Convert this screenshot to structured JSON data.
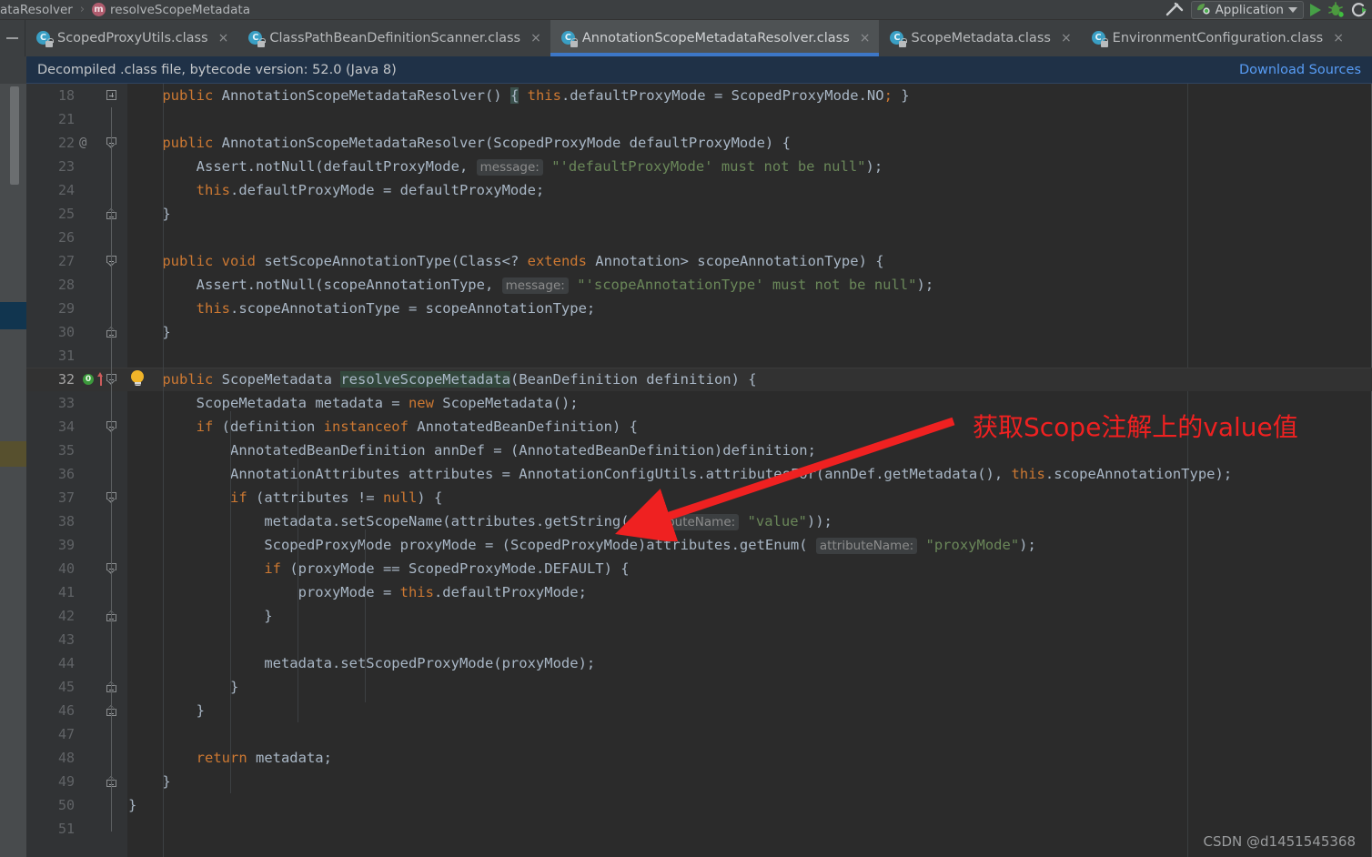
{
  "breadcrumb": {
    "class_fragment": "ataResolver",
    "separator": "›",
    "method_icon": "m",
    "method": "resolveScopeMetadata"
  },
  "toolbar": {
    "build_icon": "hammer-icon",
    "run_config_label": "Application",
    "run_config_icon": "application-run-icon",
    "run_icon": "run-icon",
    "debug_icon": "debug-icon",
    "rerun_icon": "rerun-icon"
  },
  "tabs": {
    "collapse_label": "—",
    "items": [
      {
        "label": "ScopedProxyUtils.class",
        "icon": "java-class-decompiled-icon",
        "active": false,
        "closable": true
      },
      {
        "label": "ClassPathBeanDefinitionScanner.class",
        "icon": "java-class-decompiled-icon",
        "active": false,
        "closable": true
      },
      {
        "label": "AnnotationScopeMetadataResolver.class",
        "icon": "java-class-decompiled-icon",
        "active": true,
        "closable": true
      },
      {
        "label": "ScopeMetadata.class",
        "icon": "java-class-decompiled-icon",
        "active": false,
        "closable": true
      },
      {
        "label": "EnvironmentConfiguration.class",
        "icon": "java-class-decompiled-icon",
        "active": false,
        "closable": true
      }
    ]
  },
  "banner": {
    "message": "Decompiled .class file, bytecode version: 52.0 (Java 8)",
    "link": "Download Sources"
  },
  "editor": {
    "current_line": 32,
    "lines": [
      {
        "n": "18",
        "anno": "",
        "fold": "plus",
        "cur": false,
        "tokens": [
          {
            "t": "    ",
            "c": "punc"
          },
          {
            "t": "public ",
            "c": "kw"
          },
          {
            "t": "AnnotationScopeMetadataResolver",
            "c": "typ"
          },
          {
            "t": "() ",
            "c": "punc"
          },
          {
            "t": "{",
            "c": "brace-hl"
          },
          {
            "t": " ",
            "c": "punc"
          },
          {
            "t": "this",
            "c": "kw"
          },
          {
            "t": ".defaultProxyMode = ",
            "c": "punc"
          },
          {
            "t": "ScopedProxyMode",
            "c": "typ"
          },
          {
            "t": ".NO",
            "c": "punc"
          },
          {
            "t": ";",
            "c": "kw"
          },
          {
            "t": " }",
            "c": "punc"
          }
        ]
      },
      {
        "n": "21",
        "anno": "",
        "fold": "",
        "cur": false,
        "tokens": []
      },
      {
        "n": "22",
        "anno": "@",
        "fold": "open",
        "cur": false,
        "tokens": [
          {
            "t": "    ",
            "c": "punc"
          },
          {
            "t": "public ",
            "c": "kw"
          },
          {
            "t": "AnnotationScopeMetadataResolver",
            "c": "typ"
          },
          {
            "t": "(",
            "c": "punc"
          },
          {
            "t": "ScopedProxyMode",
            "c": "typ"
          },
          {
            "t": " defaultProxyMode) {",
            "c": "punc"
          }
        ]
      },
      {
        "n": "23",
        "anno": "",
        "fold": "",
        "cur": false,
        "tokens": [
          {
            "t": "        ",
            "c": "punc"
          },
          {
            "t": "Assert",
            "c": "typ"
          },
          {
            "t": ".notNull(defaultProxyMode, ",
            "c": "punc"
          },
          {
            "t": "message:",
            "c": "hint"
          },
          {
            "t": " ",
            "c": "punc"
          },
          {
            "t": "\"'defaultProxyMode' must not be null\"",
            "c": "str"
          },
          {
            "t": ");",
            "c": "punc"
          }
        ]
      },
      {
        "n": "24",
        "anno": "",
        "fold": "",
        "cur": false,
        "tokens": [
          {
            "t": "        ",
            "c": "punc"
          },
          {
            "t": "this",
            "c": "kw"
          },
          {
            "t": ".defaultProxyMode = defaultProxyMode;",
            "c": "punc"
          }
        ]
      },
      {
        "n": "25",
        "anno": "",
        "fold": "close",
        "cur": false,
        "tokens": [
          {
            "t": "    }",
            "c": "punc"
          }
        ]
      },
      {
        "n": "26",
        "anno": "",
        "fold": "",
        "cur": false,
        "tokens": []
      },
      {
        "n": "27",
        "anno": "",
        "fold": "open",
        "cur": false,
        "tokens": [
          {
            "t": "    ",
            "c": "punc"
          },
          {
            "t": "public void ",
            "c": "kw"
          },
          {
            "t": "setScopeAnnotationType",
            "c": "typ"
          },
          {
            "t": "(",
            "c": "punc"
          },
          {
            "t": "Class",
            "c": "typ"
          },
          {
            "t": "<? ",
            "c": "punc"
          },
          {
            "t": "extends ",
            "c": "kw"
          },
          {
            "t": "Annotation",
            "c": "typ"
          },
          {
            "t": "> scopeAnnotationType) {",
            "c": "punc"
          }
        ]
      },
      {
        "n": "28",
        "anno": "",
        "fold": "",
        "cur": false,
        "tokens": [
          {
            "t": "        ",
            "c": "punc"
          },
          {
            "t": "Assert",
            "c": "typ"
          },
          {
            "t": ".notNull(scopeAnnotationType, ",
            "c": "punc"
          },
          {
            "t": "message:",
            "c": "hint"
          },
          {
            "t": " ",
            "c": "punc"
          },
          {
            "t": "\"'scopeAnnotationType' must not be null\"",
            "c": "str"
          },
          {
            "t": ");",
            "c": "punc"
          }
        ]
      },
      {
        "n": "29",
        "anno": "",
        "fold": "",
        "cur": false,
        "tokens": [
          {
            "t": "        ",
            "c": "punc"
          },
          {
            "t": "this",
            "c": "kw"
          },
          {
            "t": ".scopeAnnotationType = scopeAnnotationType;",
            "c": "punc"
          }
        ]
      },
      {
        "n": "30",
        "anno": "",
        "fold": "close",
        "cur": false,
        "tokens": [
          {
            "t": "    }",
            "c": "punc"
          }
        ]
      },
      {
        "n": "31",
        "anno": "",
        "fold": "",
        "cur": false,
        "tokens": []
      },
      {
        "n": "32",
        "anno": "",
        "fold": "open",
        "cur": true,
        "tokens": [
          {
            "t": "    ",
            "c": "punc"
          },
          {
            "t": "public ",
            "c": "kw"
          },
          {
            "t": "ScopeMetadata",
            "c": "typ"
          },
          {
            "t": " ",
            "c": "punc"
          },
          {
            "t": "resolveScopeMetadata",
            "c": "hl-meth"
          },
          {
            "t": "(",
            "c": "punc"
          },
          {
            "t": "BeanDefinition",
            "c": "typ"
          },
          {
            "t": " definition) {",
            "c": "punc"
          }
        ]
      },
      {
        "n": "33",
        "anno": "",
        "fold": "",
        "cur": false,
        "tokens": [
          {
            "t": "        ",
            "c": "punc"
          },
          {
            "t": "ScopeMetadata",
            "c": "typ"
          },
          {
            "t": " metadata = ",
            "c": "punc"
          },
          {
            "t": "new ",
            "c": "kw"
          },
          {
            "t": "ScopeMetadata",
            "c": "typ"
          },
          {
            "t": "();",
            "c": "punc"
          }
        ]
      },
      {
        "n": "34",
        "anno": "",
        "fold": "open",
        "cur": false,
        "tokens": [
          {
            "t": "        ",
            "c": "punc"
          },
          {
            "t": "if ",
            "c": "kw"
          },
          {
            "t": "(definition ",
            "c": "punc"
          },
          {
            "t": "instanceof ",
            "c": "kw"
          },
          {
            "t": "AnnotatedBeanDefinition",
            "c": "typ"
          },
          {
            "t": ") {",
            "c": "punc"
          }
        ]
      },
      {
        "n": "35",
        "anno": "",
        "fold": "",
        "cur": false,
        "tokens": [
          {
            "t": "            ",
            "c": "punc"
          },
          {
            "t": "AnnotatedBeanDefinition",
            "c": "typ"
          },
          {
            "t": " annDef = (",
            "c": "punc"
          },
          {
            "t": "AnnotatedBeanDefinition",
            "c": "typ"
          },
          {
            "t": ")definition;",
            "c": "punc"
          }
        ]
      },
      {
        "n": "36",
        "anno": "",
        "fold": "",
        "cur": false,
        "tokens": [
          {
            "t": "            ",
            "c": "punc"
          },
          {
            "t": "AnnotationAttributes",
            "c": "typ"
          },
          {
            "t": " attributes = ",
            "c": "punc"
          },
          {
            "t": "AnnotationConfigUtils",
            "c": "typ"
          },
          {
            "t": ".attributesFor(annDef.getMetadata(), ",
            "c": "punc"
          },
          {
            "t": "this",
            "c": "kw"
          },
          {
            "t": ".scopeAnnotationType);",
            "c": "punc"
          }
        ]
      },
      {
        "n": "37",
        "anno": "",
        "fold": "open",
        "cur": false,
        "tokens": [
          {
            "t": "            ",
            "c": "punc"
          },
          {
            "t": "if ",
            "c": "kw"
          },
          {
            "t": "(attributes != ",
            "c": "punc"
          },
          {
            "t": "null",
            "c": "kw"
          },
          {
            "t": ") {",
            "c": "punc"
          }
        ]
      },
      {
        "n": "38",
        "anno": "",
        "fold": "",
        "cur": false,
        "tokens": [
          {
            "t": "                ",
            "c": "punc"
          },
          {
            "t": "metadata.setScopeName(attributes.getString( ",
            "c": "punc"
          },
          {
            "t": "attributeName:",
            "c": "hint"
          },
          {
            "t": " ",
            "c": "punc"
          },
          {
            "t": "\"value\"",
            "c": "str"
          },
          {
            "t": "));",
            "c": "punc"
          }
        ]
      },
      {
        "n": "39",
        "anno": "",
        "fold": "",
        "cur": false,
        "tokens": [
          {
            "t": "                ",
            "c": "punc"
          },
          {
            "t": "ScopedProxyMode",
            "c": "typ"
          },
          {
            "t": " proxyMode = (",
            "c": "punc"
          },
          {
            "t": "ScopedProxyMode",
            "c": "typ"
          },
          {
            "t": ")attributes.getEnum( ",
            "c": "punc"
          },
          {
            "t": "attributeName:",
            "c": "hint"
          },
          {
            "t": " ",
            "c": "punc"
          },
          {
            "t": "\"proxyMode\"",
            "c": "str"
          },
          {
            "t": ");",
            "c": "punc"
          }
        ]
      },
      {
        "n": "40",
        "anno": "",
        "fold": "open",
        "cur": false,
        "tokens": [
          {
            "t": "                ",
            "c": "punc"
          },
          {
            "t": "if ",
            "c": "kw"
          },
          {
            "t": "(proxyMode == ",
            "c": "punc"
          },
          {
            "t": "ScopedProxyMode",
            "c": "typ"
          },
          {
            "t": ".DEFAULT) {",
            "c": "punc"
          }
        ]
      },
      {
        "n": "41",
        "anno": "",
        "fold": "",
        "cur": false,
        "tokens": [
          {
            "t": "                    ",
            "c": "punc"
          },
          {
            "t": "proxyMode = ",
            "c": "punc"
          },
          {
            "t": "this",
            "c": "kw"
          },
          {
            "t": ".defaultProxyMode;",
            "c": "punc"
          }
        ]
      },
      {
        "n": "42",
        "anno": "",
        "fold": "close",
        "cur": false,
        "tokens": [
          {
            "t": "                }",
            "c": "punc"
          }
        ]
      },
      {
        "n": "43",
        "anno": "",
        "fold": "",
        "cur": false,
        "tokens": []
      },
      {
        "n": "44",
        "anno": "",
        "fold": "",
        "cur": false,
        "tokens": [
          {
            "t": "                ",
            "c": "punc"
          },
          {
            "t": "metadata.setScopedProxyMode(proxyMode);",
            "c": "punc"
          }
        ]
      },
      {
        "n": "45",
        "anno": "",
        "fold": "close",
        "cur": false,
        "tokens": [
          {
            "t": "            }",
            "c": "punc"
          }
        ]
      },
      {
        "n": "46",
        "anno": "",
        "fold": "close",
        "cur": false,
        "tokens": [
          {
            "t": "        }",
            "c": "punc"
          }
        ]
      },
      {
        "n": "47",
        "anno": "",
        "fold": "",
        "cur": false,
        "tokens": []
      },
      {
        "n": "48",
        "anno": "",
        "fold": "",
        "cur": false,
        "tokens": [
          {
            "t": "        ",
            "c": "punc"
          },
          {
            "t": "return ",
            "c": "kw"
          },
          {
            "t": "metadata;",
            "c": "punc"
          }
        ]
      },
      {
        "n": "49",
        "anno": "",
        "fold": "close",
        "cur": false,
        "tokens": [
          {
            "t": "    }",
            "c": "punc"
          }
        ]
      },
      {
        "n": "50",
        "anno": "",
        "fold": "",
        "cur": false,
        "tokens": [
          {
            "t": "}",
            "c": "punc"
          }
        ]
      },
      {
        "n": "51",
        "anno": "",
        "fold": "",
        "cur": false,
        "tokens": []
      }
    ]
  },
  "gutter_icons": {
    "usage_count": "0",
    "usage_badge_name": "usage-count-badge",
    "override_arrow_name": "overriding-method-icon",
    "bulb_name": "intention-bulb-icon"
  },
  "annotation": {
    "text": "获取Scope注解上的value值",
    "color": "#ef2121",
    "arrow_target_line": "38"
  },
  "watermark": {
    "text": "CSDN @d1451545368"
  },
  "colors": {
    "editor_bg": "#2b2b2b",
    "gutter_bg": "#313335",
    "chrome_bg": "#3c3f41",
    "tab_active_bg": "#4e5254",
    "tab_underline": "#3d77c7",
    "banner_bg": "#1f3147",
    "link": "#589df6",
    "keyword": "#cc7832",
    "string": "#6a8759",
    "identifier": "#a9b7c6",
    "annotation_red": "#ef2121"
  }
}
